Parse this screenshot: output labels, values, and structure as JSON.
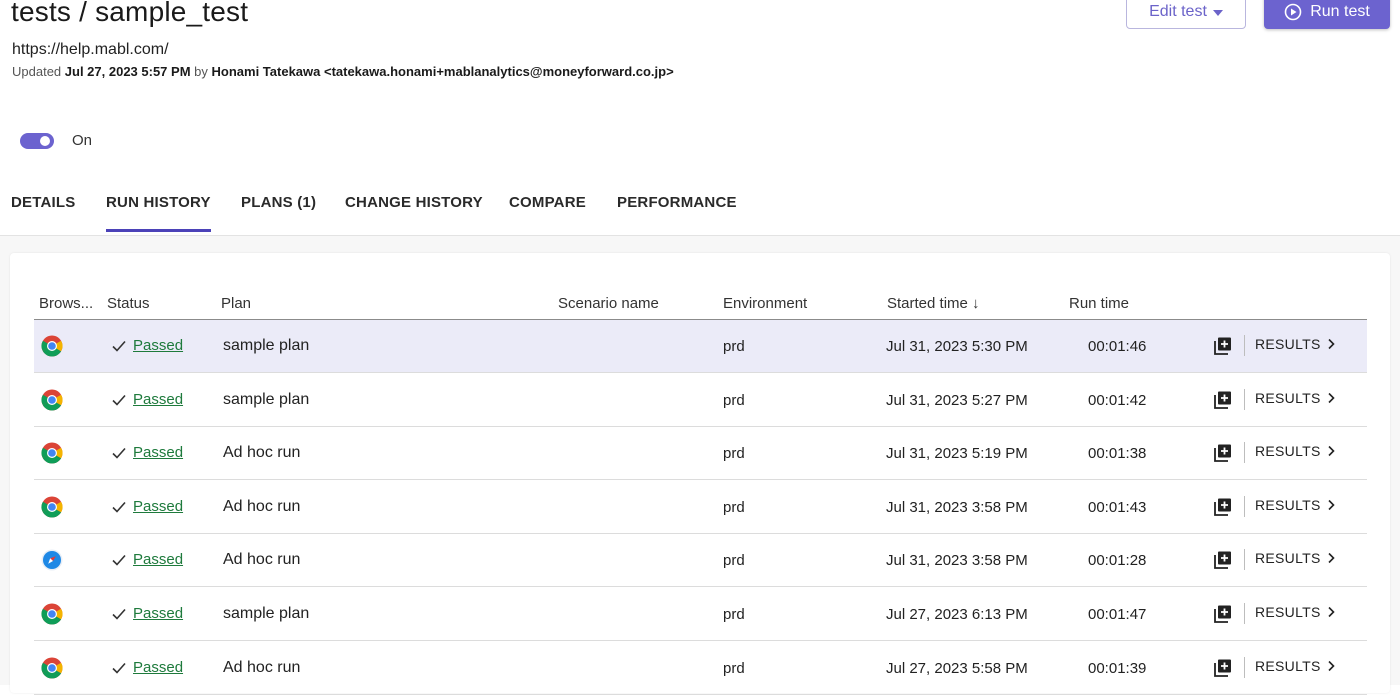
{
  "header": {
    "title": "tests / sample_test",
    "url": "https://help.mabl.com/",
    "updated_prefix": "Updated",
    "updated_date": "Jul 27, 2023 5:57 PM",
    "updated_by_word": "by",
    "updated_by": "Honami Tatekawa <tatekawa.honami+mablanalytics@moneyforward.co.jp>",
    "edit_button": "Edit test",
    "run_button": "Run test"
  },
  "toggle": {
    "label": "On",
    "state": true
  },
  "tabs": [
    {
      "label": "DETAILS"
    },
    {
      "label": "RUN HISTORY",
      "active": true
    },
    {
      "label": "PLANS (1)"
    },
    {
      "label": "CHANGE HISTORY"
    },
    {
      "label": "COMPARE"
    },
    {
      "label": "PERFORMANCE"
    }
  ],
  "table": {
    "headers": {
      "browser": "Brows...",
      "status": "Status",
      "plan": "Plan",
      "scenario": "Scenario name",
      "environment": "Environment",
      "started": "Started time ↓",
      "runtime": "Run time"
    },
    "results_label": "RESULTS",
    "rows": [
      {
        "browser": "chrome",
        "status": "Passed",
        "plan": "sample plan",
        "scenario": "",
        "environment": "prd",
        "started": "Jul 31, 2023 5:30 PM",
        "runtime": "00:01:46"
      },
      {
        "browser": "chrome",
        "status": "Passed",
        "plan": "sample plan",
        "scenario": "",
        "environment": "prd",
        "started": "Jul 31, 2023 5:27 PM",
        "runtime": "00:01:42"
      },
      {
        "browser": "chrome",
        "status": "Passed",
        "plan": "Ad hoc run",
        "scenario": "",
        "environment": "prd",
        "started": "Jul 31, 2023 5:19 PM",
        "runtime": "00:01:38"
      },
      {
        "browser": "chrome",
        "status": "Passed",
        "plan": "Ad hoc run",
        "scenario": "",
        "environment": "prd",
        "started": "Jul 31, 2023 3:58 PM",
        "runtime": "00:01:43"
      },
      {
        "browser": "safari",
        "status": "Passed",
        "plan": "Ad hoc run",
        "scenario": "",
        "environment": "prd",
        "started": "Jul 31, 2023 3:58 PM",
        "runtime": "00:01:28"
      },
      {
        "browser": "chrome",
        "status": "Passed",
        "plan": "sample plan",
        "scenario": "",
        "environment": "prd",
        "started": "Jul 27, 2023 6:13 PM",
        "runtime": "00:01:47"
      },
      {
        "browser": "chrome",
        "status": "Passed",
        "plan": "Ad hoc run",
        "scenario": "",
        "environment": "prd",
        "started": "Jul 27, 2023 5:58 PM",
        "runtime": "00:01:39"
      }
    ]
  },
  "colors": {
    "accent": "#6c63cf",
    "tab_underline": "#4b42b8",
    "passed": "#1e7a3c",
    "highlight_row": "#ebebf8"
  }
}
